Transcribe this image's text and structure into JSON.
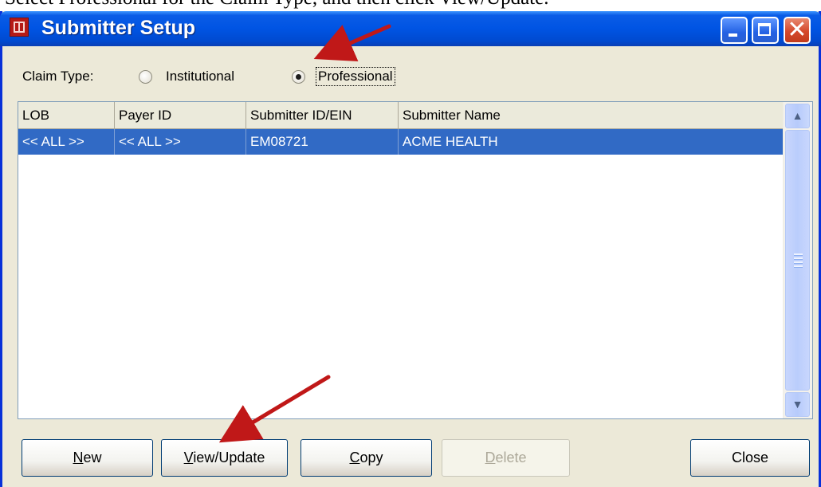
{
  "caption": "Select Professional for the Claim Type, and then click View/Update.",
  "window": {
    "title": "Submitter Setup"
  },
  "claim_type": {
    "label": "Claim Type:",
    "options": [
      {
        "label": "Institutional",
        "checked": false
      },
      {
        "label": "Professional",
        "checked": true
      }
    ]
  },
  "table": {
    "columns": [
      "LOB",
      "Payer ID",
      "Submitter ID/EIN",
      "Submitter Name"
    ],
    "rows": [
      {
        "lob": "<< ALL >>",
        "payer_id": "<< ALL >>",
        "submitter_id": "EM08721",
        "submitter_name": "ACME HEALTH",
        "selected": true
      }
    ]
  },
  "buttons": {
    "new": {
      "accel": "N",
      "rest": "ew"
    },
    "view_update": {
      "accel": "V",
      "rest": "iew/Update"
    },
    "copy": {
      "accel": "C",
      "rest": "opy"
    },
    "delete": {
      "accel": "D",
      "rest": "elete",
      "disabled": true
    },
    "close": "Close"
  },
  "colors": {
    "selection": "#316ac5",
    "titlebar": "#0054e3",
    "arrow": "#c01818"
  }
}
